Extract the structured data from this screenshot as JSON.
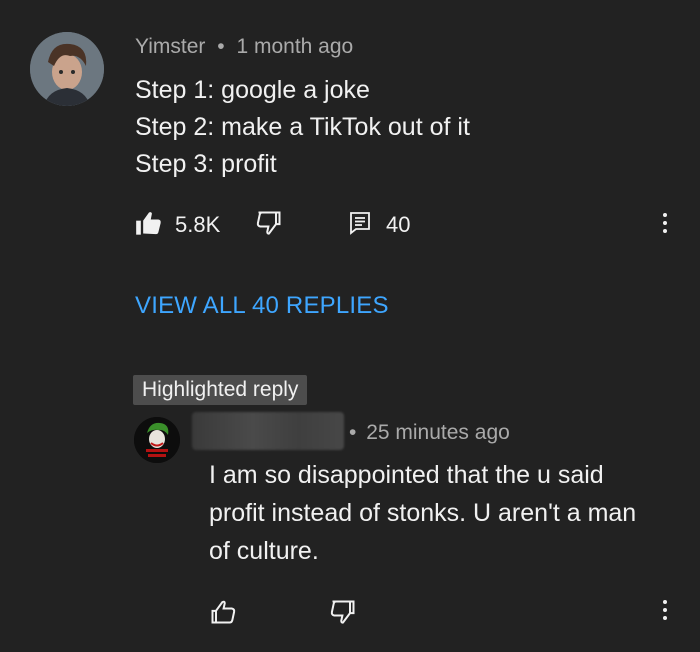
{
  "comment": {
    "author": "Yimster",
    "separator": "•",
    "time": "1 month ago",
    "lines": [
      "Step 1: google a joke",
      "Step 2: make a TikTok out of it",
      "Step 3: profit"
    ],
    "likes": "5.8K",
    "replies_count": "40",
    "view_replies_label": "VIEW ALL 40 REPLIES"
  },
  "reply": {
    "badge": "Highlighted reply",
    "separator": "•",
    "time": "25 minutes ago",
    "lines": [
      "I am so disappointed that the u said",
      "profit instead of stonks. U aren't a man",
      "of culture."
    ]
  },
  "icons": {
    "like_filled": "thumbs-up-filled-icon",
    "dislike": "thumbs-down-icon",
    "reply": "comment-icon",
    "more": "more-vertical-icon",
    "like_outline": "thumbs-up-icon"
  },
  "colors": {
    "background": "#222222",
    "text": "#f1f1f1",
    "muted": "#aaaaaa",
    "link": "#3ea6ff",
    "badge_bg": "#4d4d4d"
  }
}
